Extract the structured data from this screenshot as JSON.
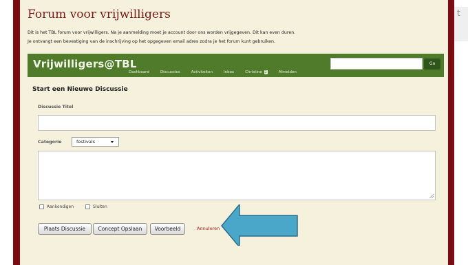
{
  "site": {
    "title": "Forum voor vrijwilligers",
    "intro_line1": "Dit is het TBL forum voor vrijwilligers. Na je aanmelding moet je account door ons worden vrijgegeven. Dit kan even duren.",
    "intro_line2": "Je ontvangt een bevestiging van de inschrijving op het opgegeven email adres zodra je het forum kunt gebruiken."
  },
  "navbar": {
    "brand": "Vrijwilligers@TBL",
    "links": [
      "Dashboard",
      "Discussies",
      "Activiteiten",
      "Inbox",
      "Christine",
      "Afmelden"
    ],
    "badge": "2",
    "search_placeholder": "",
    "go_label": "Ga"
  },
  "form": {
    "heading": "Start een Nieuwe Discussie",
    "title_label": "Discussie Titel",
    "title_value": "",
    "category_label": "Categorie",
    "category_value": "festivals",
    "body_value": "",
    "announce_label": "Aankondigen",
    "close_label": "Sluiten",
    "buttons": {
      "post": "Plaats Discussie",
      "save_draft": "Concept Opslaan",
      "preview": "Voorbeeld",
      "cancel": "Annuleren"
    }
  },
  "colors": {
    "maroon": "#7a0c12",
    "page_bg": "#f6f1dc",
    "nav_green": "#4f7b2a",
    "title_red": "#7e1b16",
    "arrow_blue": "#4aa7c9"
  },
  "icons": [
    "dropdown-arrow-icon",
    "resize-grip-icon",
    "callout-arrow-icon"
  ]
}
